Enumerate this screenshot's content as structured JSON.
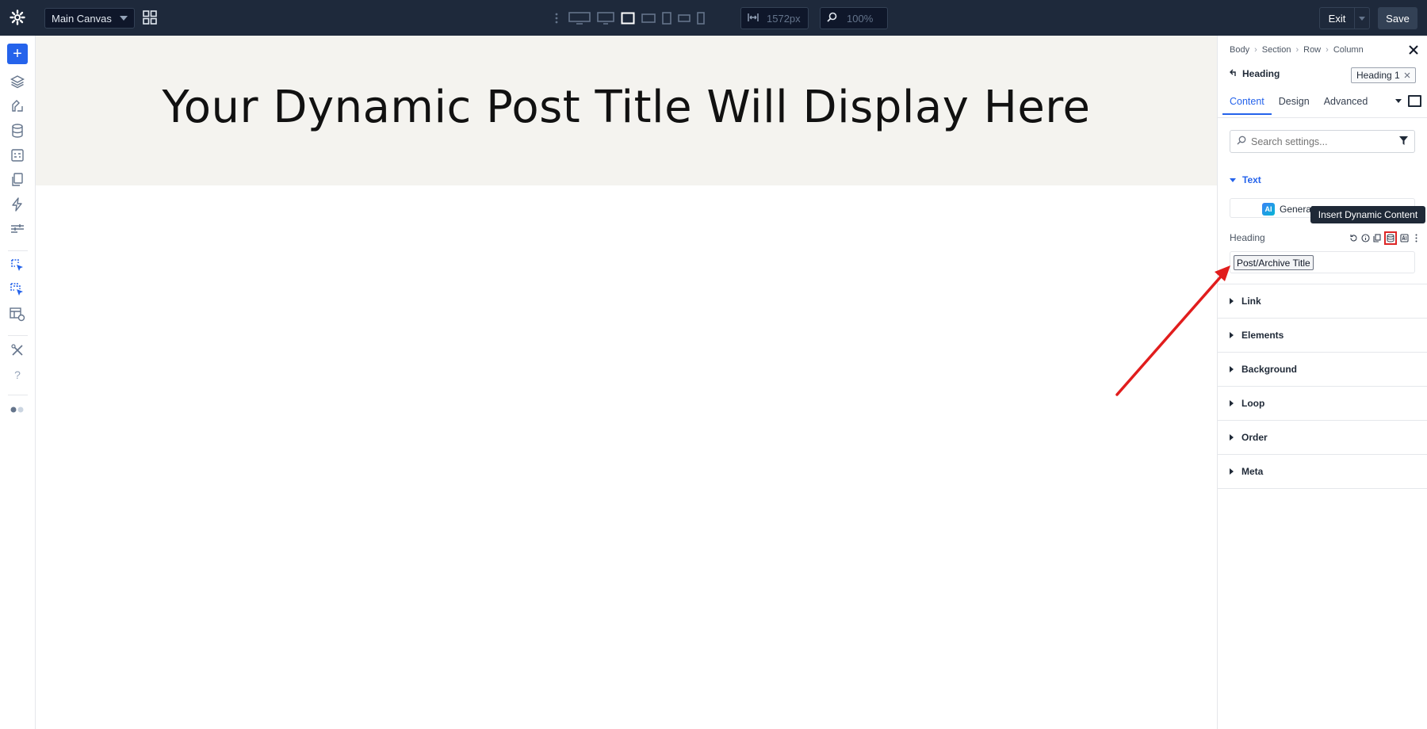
{
  "topbar": {
    "canvas_select": "Main Canvas",
    "width_value": "1572px",
    "zoom_value": "100%",
    "exit_label": "Exit",
    "save_label": "Save",
    "bg_color": "#1e293b"
  },
  "canvas": {
    "heading": "Your Dynamic Post Title Will Display Here",
    "hero_bg": "#f4f3ef"
  },
  "panel": {
    "breadcrumb": [
      "Body",
      "Section",
      "Row",
      "Column"
    ],
    "element_name": "Heading",
    "tag": "Heading 1",
    "tabs": [
      "Content",
      "Design",
      "Advanced"
    ],
    "search_placeholder": "Search settings...",
    "text_section": "Text",
    "ai_label": "Generat",
    "ai_badge": "AI",
    "field_label": "Heading",
    "field_value_chip": "Post/Archive Title",
    "tooltip": "Insert Dynamic Content",
    "sections": [
      "Link",
      "Elements",
      "Background",
      "Loop",
      "Order",
      "Meta"
    ],
    "accent_color": "#2563eb",
    "highlight_color": "#dc2626"
  }
}
